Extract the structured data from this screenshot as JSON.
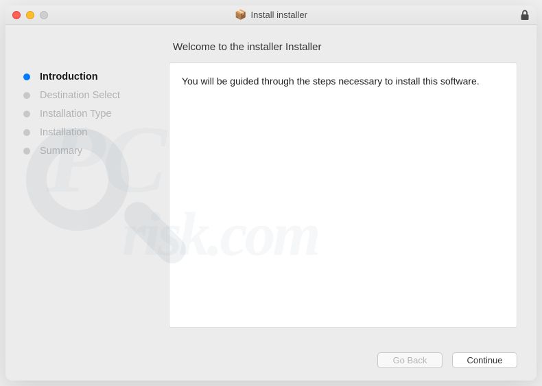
{
  "window": {
    "title": "Install installer"
  },
  "sidebar": {
    "steps": [
      {
        "label": "Introduction",
        "active": true
      },
      {
        "label": "Destination Select",
        "active": false
      },
      {
        "label": "Installation Type",
        "active": false
      },
      {
        "label": "Installation",
        "active": false
      },
      {
        "label": "Summary",
        "active": false
      }
    ]
  },
  "main": {
    "heading": "Welcome to the installer Installer",
    "body_text": "You will be guided through the steps necessary to install this software."
  },
  "buttons": {
    "go_back": "Go Back",
    "continue": "Continue"
  },
  "watermark": {
    "line1": "PC",
    "line2": "risk.com"
  }
}
